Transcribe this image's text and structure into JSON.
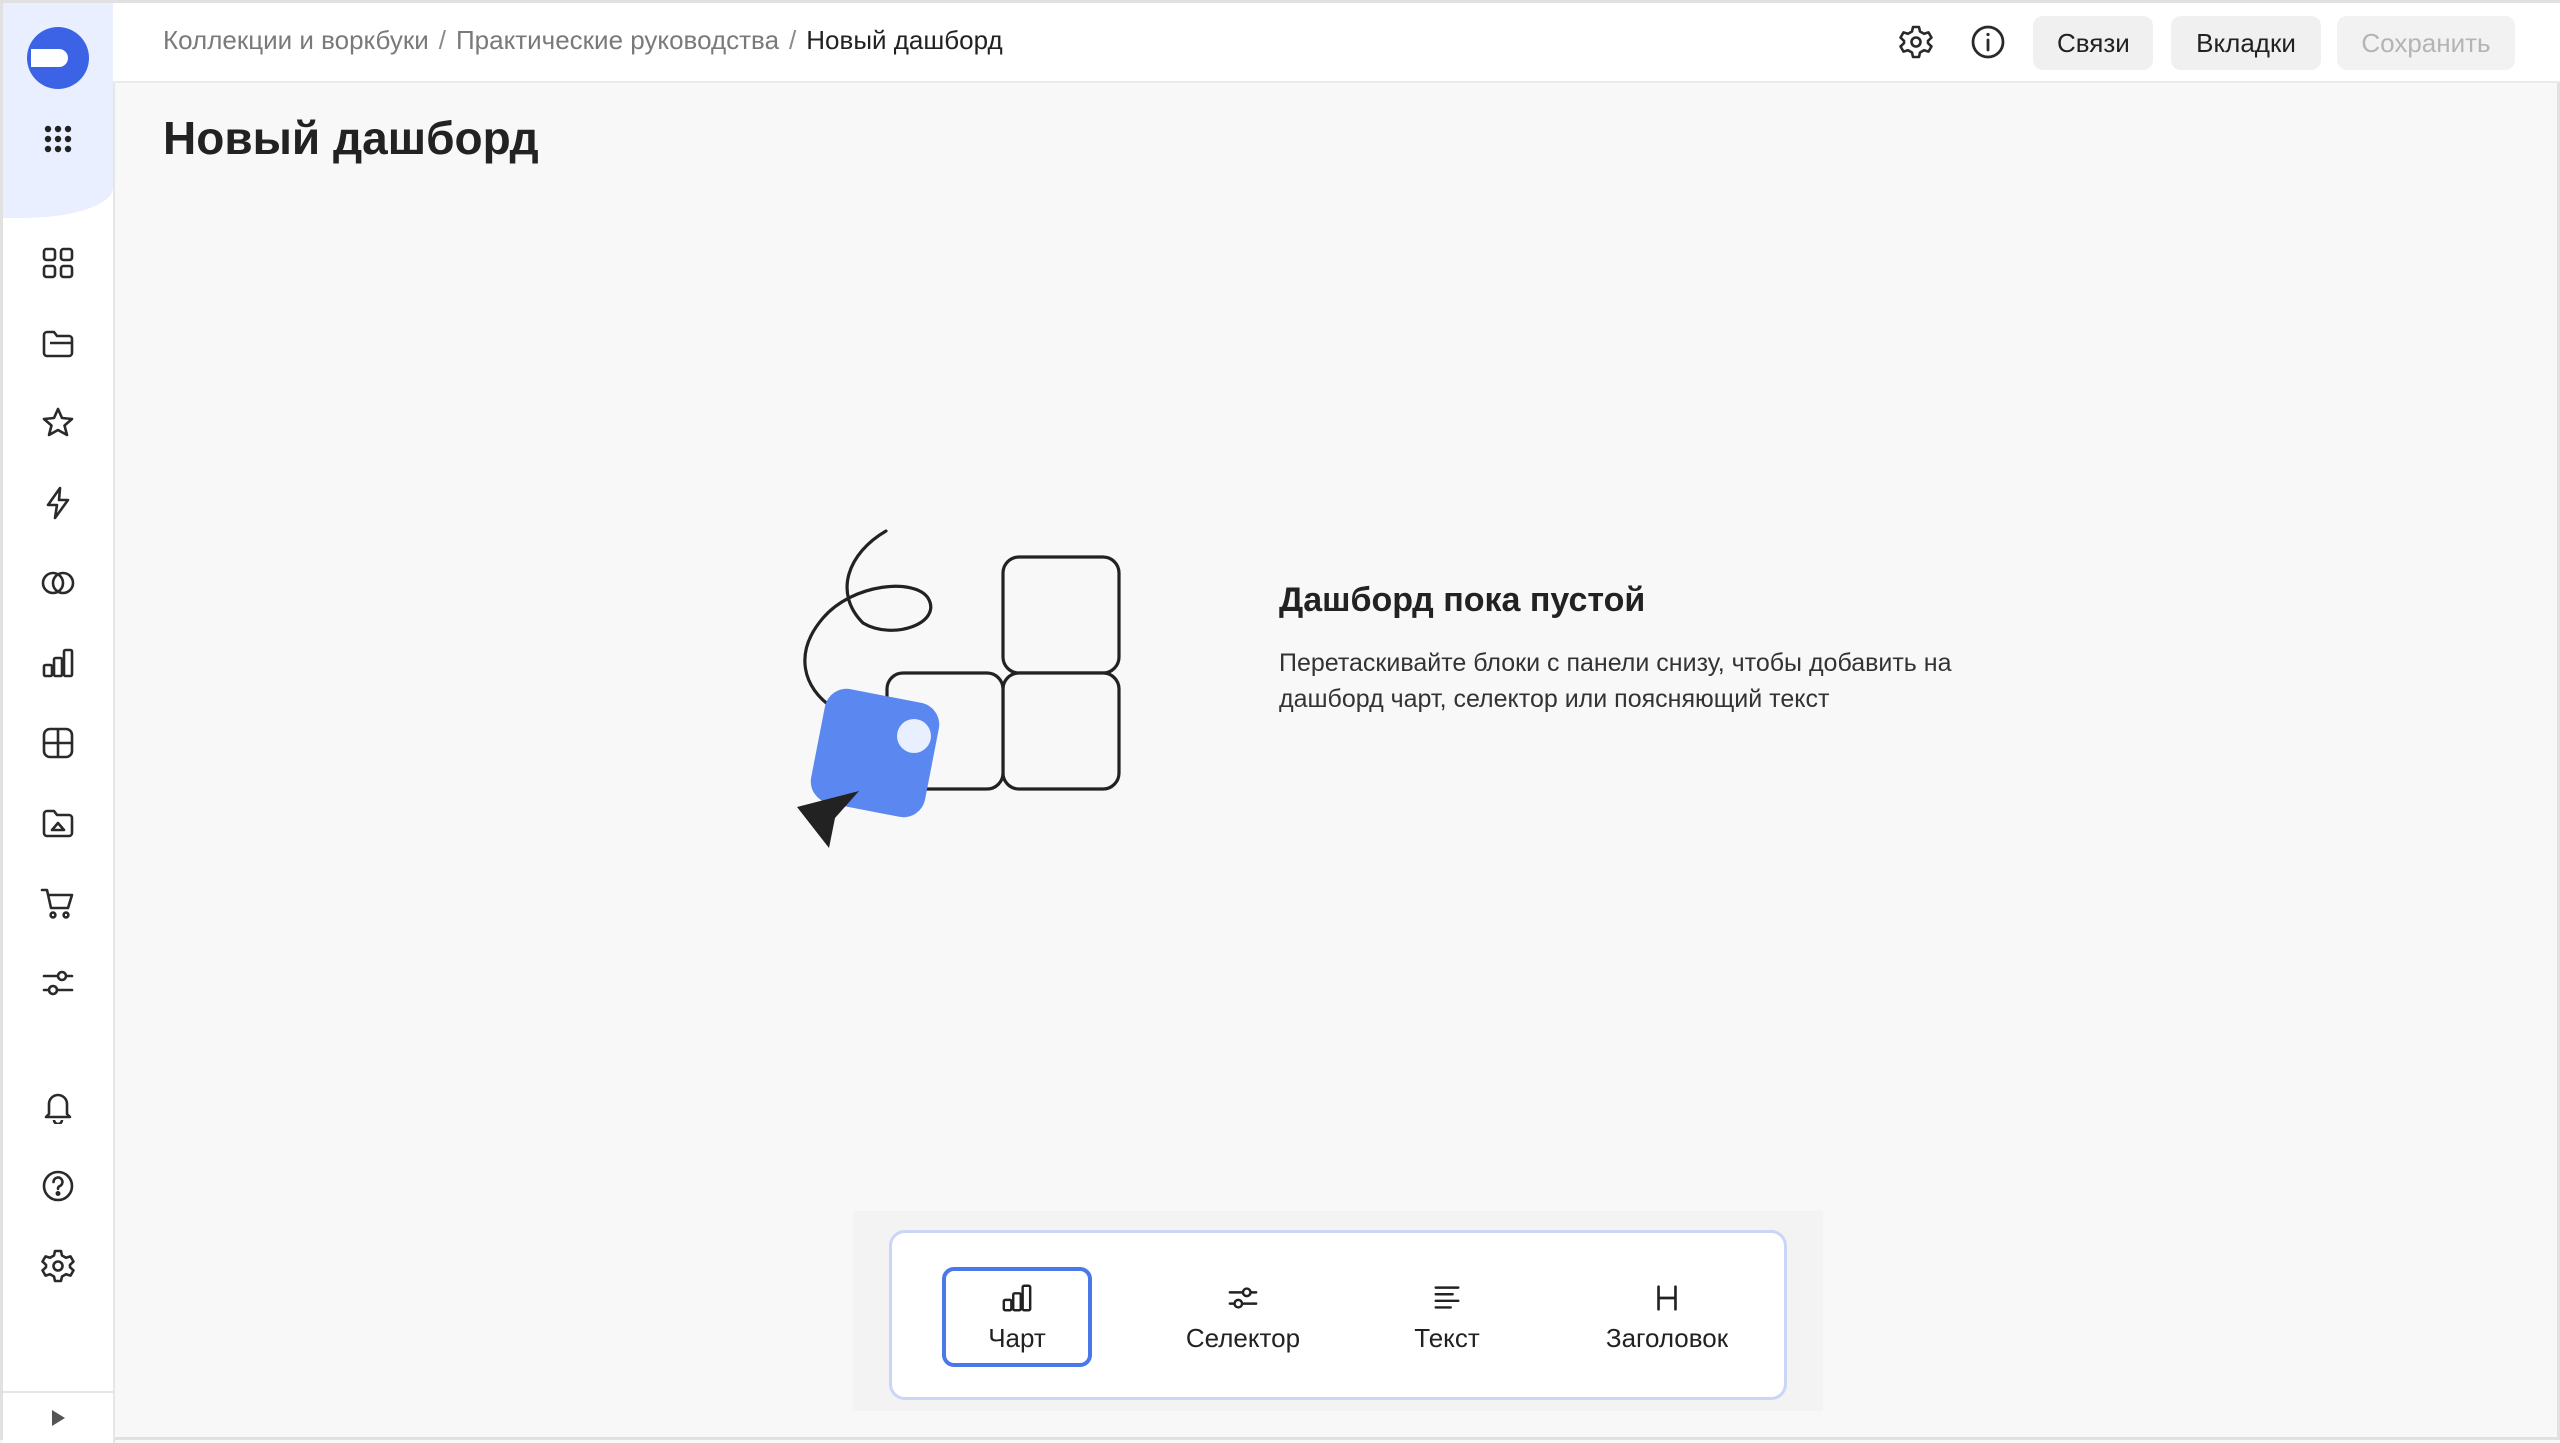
{
  "breadcrumb": {
    "items": [
      "Коллекции и воркбуки",
      "Практические руководства"
    ],
    "separator": "/",
    "current": "Новый дашборд"
  },
  "header": {
    "links_label": "Связи",
    "tabs_label": "Вкладки",
    "save_label": "Сохранить"
  },
  "page": {
    "title": "Новый дашборд"
  },
  "empty_state": {
    "title": "Дашборд пока пустой",
    "description": "Перетаскивайте блоки с панели снизу, чтобы добавить на дашборд чарт, селектор или поясняющий текст"
  },
  "widgets": [
    {
      "label": "Чарт",
      "icon": "chart-icon",
      "active": true
    },
    {
      "label": "Селектор",
      "icon": "selector-icon",
      "active": false
    },
    {
      "label": "Текст",
      "icon": "text-icon",
      "active": false
    },
    {
      "label": "Заголовок",
      "icon": "heading-icon",
      "active": false
    }
  ],
  "sidebar": {
    "icons": [
      "apps-icon",
      "collections-icon",
      "favorites-icon",
      "connections-icon",
      "datasets-icon",
      "charts-icon",
      "dashboards-icon",
      "files-icon",
      "marketplace-icon",
      "settings-sliders-icon",
      "notifications-icon",
      "help-icon",
      "settings-icon",
      "collapse-icon"
    ]
  },
  "colors": {
    "accent": "#4a78e8",
    "logo": "#3c63e6",
    "illustration": "#5a87f0"
  }
}
